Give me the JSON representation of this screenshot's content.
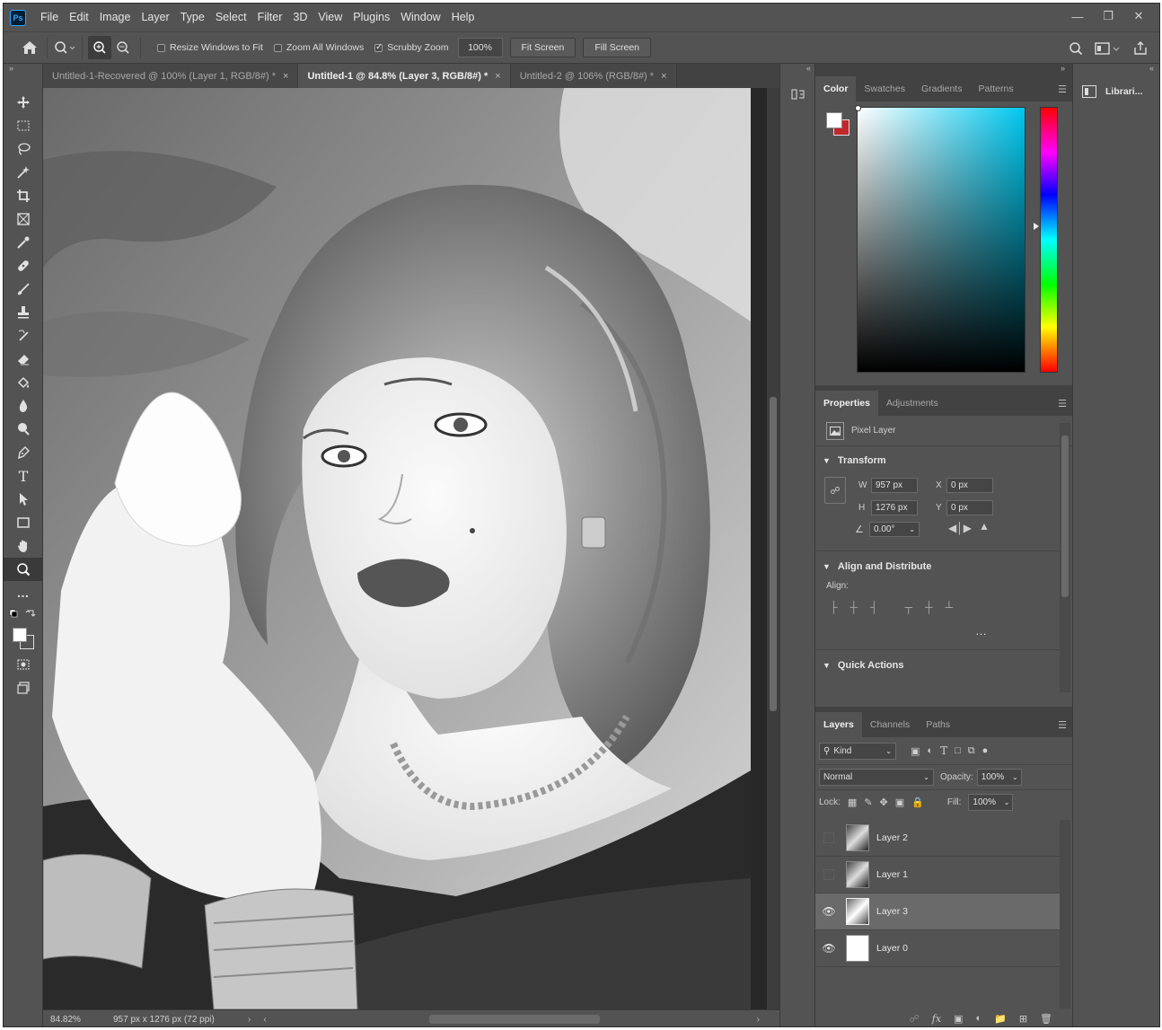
{
  "app": {
    "menu": [
      "File",
      "Edit",
      "Image",
      "Layer",
      "Type",
      "Select",
      "Filter",
      "3D",
      "View",
      "Plugins",
      "Window",
      "Help"
    ],
    "logo": "Ps"
  },
  "options": {
    "resize_windows": "Resize Windows to Fit",
    "zoom_all": "Zoom All Windows",
    "scrubby": "Scrubby Zoom",
    "zoom_value": "100%",
    "fit_screen": "Fit Screen",
    "fill_screen": "Fill Screen"
  },
  "tabs": [
    {
      "label": "Untitled-1-Recovered @ 100% (Layer 1, RGB/8#) *",
      "active": false
    },
    {
      "label": "Untitled-1 @ 84.8% (Layer 3, RGB/8#) *",
      "active": true
    },
    {
      "label": "Untitled-2 @ 106% (RGB/8#) *",
      "active": false
    }
  ],
  "status": {
    "zoom": "84.82%",
    "doc_size": "957 px x 1276 px (72 ppi)"
  },
  "color_panel": {
    "tabs": [
      "Color",
      "Swatches",
      "Gradients",
      "Patterns"
    ],
    "fg_color": "#ffffff",
    "bg_color": "#c1272d",
    "hue_color": "#00c8f0"
  },
  "properties": {
    "tabs": [
      "Properties",
      "Adjustments"
    ],
    "kind": "Pixel Layer",
    "transform_title": "Transform",
    "w_label": "W",
    "w_value": "957 px",
    "h_label": "H",
    "h_value": "1276 px",
    "x_label": "X",
    "x_value": "0 px",
    "y_label": "Y",
    "y_value": "0 px",
    "angle_value": "0.00°",
    "align_title": "Align and Distribute",
    "align_label": "Align:",
    "quick_title": "Quick Actions"
  },
  "layers": {
    "tabs": [
      "Layers",
      "Channels",
      "Paths"
    ],
    "filter_kind": "Kind",
    "blend_mode": "Normal",
    "opacity_label": "Opacity:",
    "opacity_value": "100%",
    "lock_label": "Lock:",
    "fill_label": "Fill:",
    "fill_value": "100%",
    "items": [
      {
        "name": "Layer 2",
        "visible": false,
        "selected": false
      },
      {
        "name": "Layer 1",
        "visible": false,
        "selected": false
      },
      {
        "name": "Layer 3",
        "visible": true,
        "selected": true
      },
      {
        "name": "Layer 0",
        "visible": true,
        "selected": false
      }
    ]
  },
  "libraries": {
    "label": "Librari..."
  }
}
